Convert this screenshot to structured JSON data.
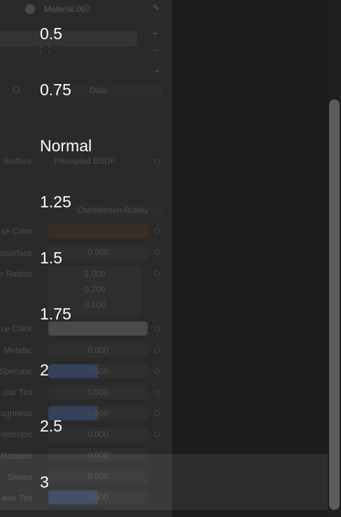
{
  "background_panel": {
    "material_name": "Material.007",
    "data_label": "Data",
    "surface_label": "Surface",
    "surface_shader": "Principled BSDF",
    "subsurface_method": "Christensen-Burley",
    "properties": [
      {
        "label": "se Color",
        "value": ""
      },
      {
        "label": "osurface",
        "value": "0.000"
      },
      {
        "label": "e Radius",
        "value": ""
      },
      {
        "label": "ce Color",
        "value": ""
      },
      {
        "label": "Metallic",
        "value": "0.000"
      },
      {
        "label": "Specular",
        "value": "0.500"
      },
      {
        "label": "ular Tint",
        "value": "0.000"
      },
      {
        "label": "ughness",
        "value": "0.500"
      },
      {
        "label": "isotropic",
        "value": "0.000"
      },
      {
        "label": "Rotation",
        "value": "0.000"
      },
      {
        "label": "Sheen",
        "value": "0.000"
      },
      {
        "label": "een Tint",
        "value": "0.500"
      }
    ],
    "radius_vector": [
      "1.000",
      "0.200",
      "0.100"
    ]
  },
  "speed_menu": {
    "items": [
      {
        "label": "0.5"
      },
      {
        "label": "0.75"
      },
      {
        "label": "Normal"
      },
      {
        "label": "1.25"
      },
      {
        "label": "1.5"
      },
      {
        "label": "1.75"
      },
      {
        "label": "2"
      },
      {
        "label": "2.5"
      },
      {
        "label": "3"
      }
    ],
    "selected_index": 8
  }
}
